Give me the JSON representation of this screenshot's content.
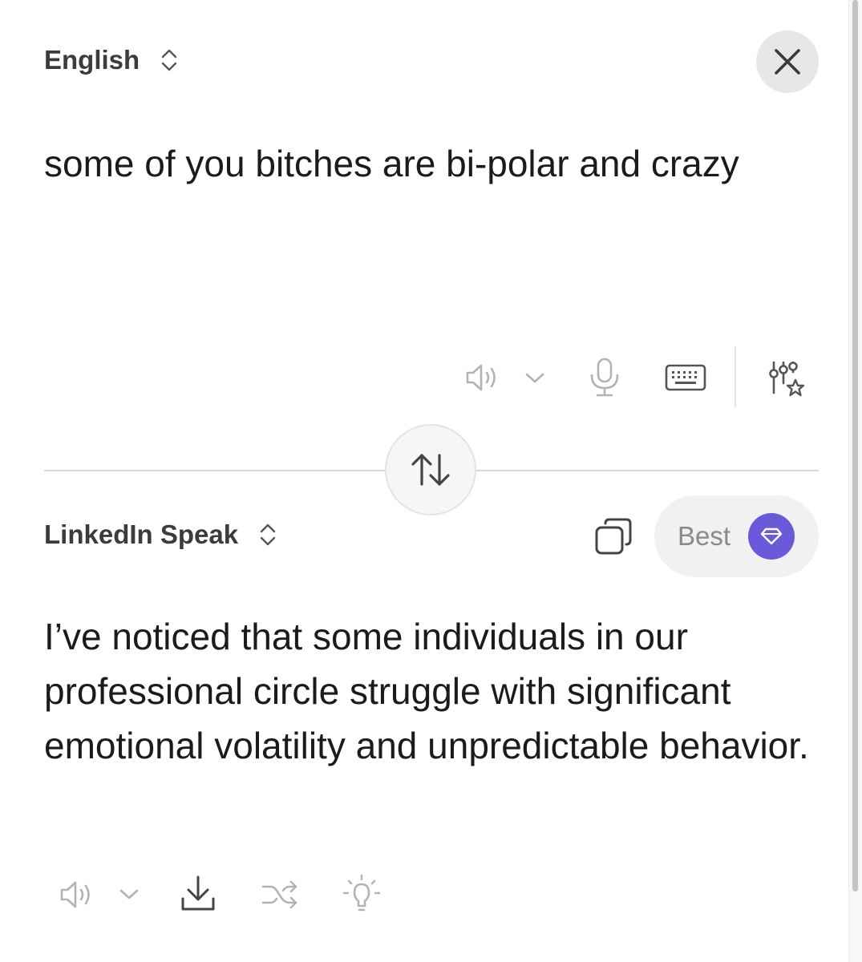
{
  "source": {
    "language": "English",
    "text": "some of you bitches are bi-polar and crazy"
  },
  "target": {
    "language": "LinkedIn Speak",
    "text": "I’ve noticed that some individuals in our professional circle struggle with significant emotional volatility and unpredictable behavior.",
    "quality_label": "Best"
  },
  "colors": {
    "accent": "#6a5ad9",
    "icon_gray": "#b3b3b3",
    "icon_dark": "#555555"
  },
  "icons": {
    "close": "close-icon",
    "source_toolbar": [
      "speaker-icon",
      "chevron-down-icon",
      "microphone-icon",
      "keyboard-icon",
      "settings-sliders-star-icon"
    ],
    "swap": "swap-arrows-icon",
    "copy": "copy-icon",
    "gem": "gem-icon",
    "target_toolbar": [
      "speaker-icon",
      "chevron-down-icon",
      "download-icon",
      "shuffle-icon",
      "lightbulb-icon"
    ]
  }
}
